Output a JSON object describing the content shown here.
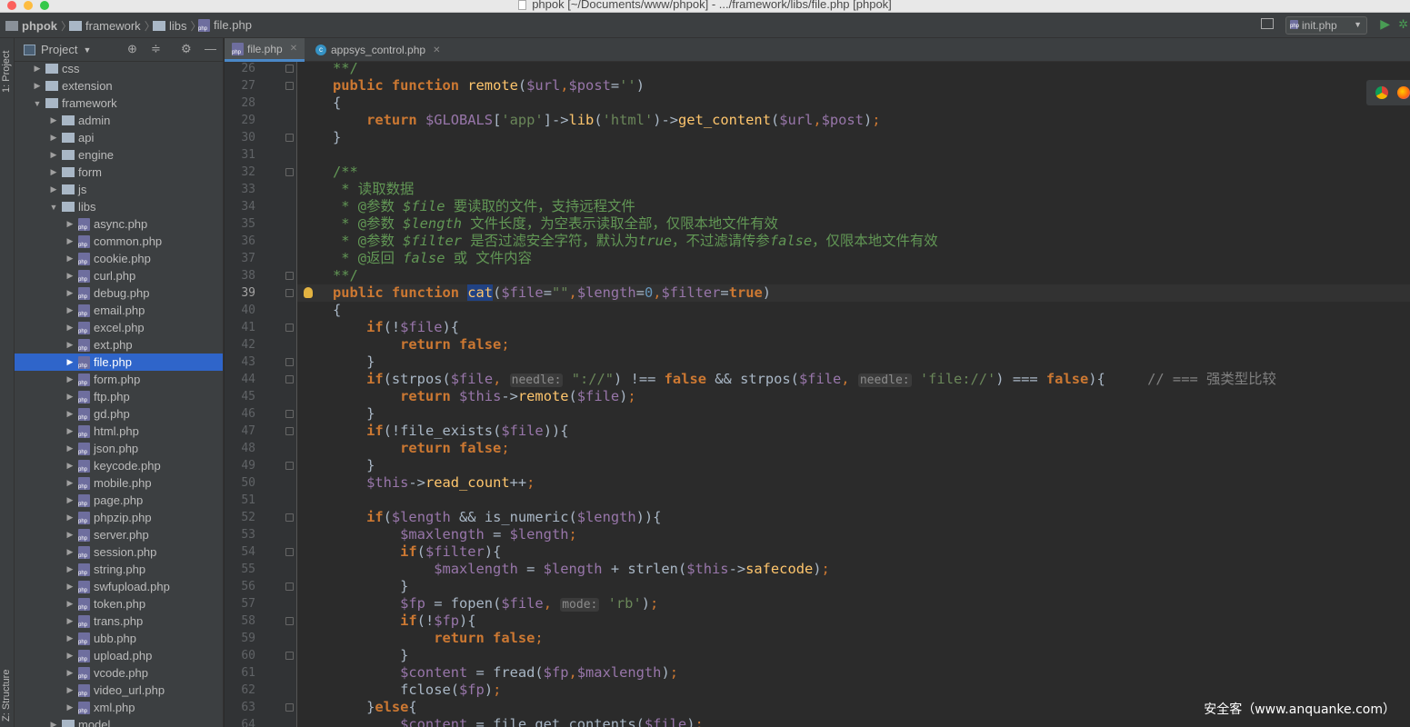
{
  "window": {
    "title": "phpok [~/Documents/www/phpok] - .../framework/libs/file.php [phpok]"
  },
  "breadcrumb": [
    "phpok",
    "framework",
    "libs",
    "file.php"
  ],
  "run_config": {
    "label": "init.php"
  },
  "tool_stripe": {
    "project_label": "1: Project",
    "structure_label": "Z: Structure"
  },
  "project_panel": {
    "title": "Project",
    "items": [
      {
        "label": "css",
        "depth": 1,
        "type": "folder",
        "expanded": false
      },
      {
        "label": "extension",
        "depth": 1,
        "type": "folder",
        "expanded": false
      },
      {
        "label": "framework",
        "depth": 1,
        "type": "folder",
        "expanded": true
      },
      {
        "label": "admin",
        "depth": 2,
        "type": "folder",
        "expanded": false
      },
      {
        "label": "api",
        "depth": 2,
        "type": "folder",
        "expanded": false
      },
      {
        "label": "engine",
        "depth": 2,
        "type": "folder",
        "expanded": false
      },
      {
        "label": "form",
        "depth": 2,
        "type": "folder",
        "expanded": false
      },
      {
        "label": "js",
        "depth": 2,
        "type": "folder",
        "expanded": false
      },
      {
        "label": "libs",
        "depth": 2,
        "type": "folder",
        "expanded": true
      },
      {
        "label": "async.php",
        "depth": 3,
        "type": "php"
      },
      {
        "label": "common.php",
        "depth": 3,
        "type": "php"
      },
      {
        "label": "cookie.php",
        "depth": 3,
        "type": "php"
      },
      {
        "label": "curl.php",
        "depth": 3,
        "type": "php"
      },
      {
        "label": "debug.php",
        "depth": 3,
        "type": "php"
      },
      {
        "label": "email.php",
        "depth": 3,
        "type": "php"
      },
      {
        "label": "excel.php",
        "depth": 3,
        "type": "php"
      },
      {
        "label": "ext.php",
        "depth": 3,
        "type": "php"
      },
      {
        "label": "file.php",
        "depth": 3,
        "type": "php",
        "selected": true
      },
      {
        "label": "form.php",
        "depth": 3,
        "type": "php"
      },
      {
        "label": "ftp.php",
        "depth": 3,
        "type": "php"
      },
      {
        "label": "gd.php",
        "depth": 3,
        "type": "php"
      },
      {
        "label": "html.php",
        "depth": 3,
        "type": "php"
      },
      {
        "label": "json.php",
        "depth": 3,
        "type": "php"
      },
      {
        "label": "keycode.php",
        "depth": 3,
        "type": "php"
      },
      {
        "label": "mobile.php",
        "depth": 3,
        "type": "php"
      },
      {
        "label": "page.php",
        "depth": 3,
        "type": "php"
      },
      {
        "label": "phpzip.php",
        "depth": 3,
        "type": "php"
      },
      {
        "label": "server.php",
        "depth": 3,
        "type": "php"
      },
      {
        "label": "session.php",
        "depth": 3,
        "type": "php"
      },
      {
        "label": "string.php",
        "depth": 3,
        "type": "php"
      },
      {
        "label": "swfupload.php",
        "depth": 3,
        "type": "php"
      },
      {
        "label": "token.php",
        "depth": 3,
        "type": "php"
      },
      {
        "label": "trans.php",
        "depth": 3,
        "type": "php"
      },
      {
        "label": "ubb.php",
        "depth": 3,
        "type": "php"
      },
      {
        "label": "upload.php",
        "depth": 3,
        "type": "php"
      },
      {
        "label": "vcode.php",
        "depth": 3,
        "type": "php"
      },
      {
        "label": "video_url.php",
        "depth": 3,
        "type": "php"
      },
      {
        "label": "xml.php",
        "depth": 3,
        "type": "php"
      },
      {
        "label": "model",
        "depth": 2,
        "type": "folder",
        "expanded": false
      }
    ]
  },
  "tabs": [
    {
      "label": "file.php",
      "active": true,
      "icon": "php-file-icon"
    },
    {
      "label": "appsys_control.php",
      "active": false,
      "icon": "class-icon"
    }
  ],
  "editor": {
    "current_line": 39,
    "lines": [
      {
        "n": 26,
        "tokens": [
          [
            "cmt",
            "**/"
          ]
        ]
      },
      {
        "n": 27,
        "tokens": [
          [
            "kw",
            "public function "
          ],
          [
            "fn",
            "remote"
          ],
          [
            "plain",
            "("
          ],
          [
            "var",
            "$url"
          ],
          [
            "kwn",
            ","
          ],
          [
            "var",
            "$post"
          ],
          [
            "plain",
            "="
          ],
          [
            "str",
            "''"
          ],
          [
            "plain",
            ")"
          ]
        ]
      },
      {
        "n": 28,
        "tokens": [
          [
            "plain",
            "{"
          ]
        ]
      },
      {
        "n": 29,
        "tokens": [
          [
            "kw",
            "    return "
          ],
          [
            "var",
            "$GLOBALS"
          ],
          [
            "plain",
            "["
          ],
          [
            "str",
            "'app'"
          ],
          [
            "plain",
            "]->"
          ],
          [
            "fn",
            "lib"
          ],
          [
            "plain",
            "("
          ],
          [
            "str",
            "'html'"
          ],
          [
            "plain",
            ")->"
          ],
          [
            "fn",
            "get_content"
          ],
          [
            "plain",
            "("
          ],
          [
            "var",
            "$url"
          ],
          [
            "kwn",
            ","
          ],
          [
            "var",
            "$post"
          ],
          [
            "plain",
            ")"
          ],
          [
            "kwn",
            ";"
          ]
        ]
      },
      {
        "n": 30,
        "tokens": [
          [
            "plain",
            "}"
          ]
        ]
      },
      {
        "n": 31,
        "tokens": []
      },
      {
        "n": 32,
        "tokens": [
          [
            "cmt",
            "/**"
          ]
        ]
      },
      {
        "n": 33,
        "tokens": [
          [
            "cmt",
            " * 读取数据"
          ]
        ]
      },
      {
        "n": 34,
        "tokens": [
          [
            "cmt",
            " * @参数 "
          ],
          [
            "cmti",
            "$file"
          ],
          [
            "cmt",
            " 要读取的文件，支持远程文件"
          ]
        ]
      },
      {
        "n": 35,
        "tokens": [
          [
            "cmt",
            " * @参数 "
          ],
          [
            "cmti",
            "$length"
          ],
          [
            "cmt",
            " 文件长度，为空表示读取全部，仅限本地文件有效"
          ]
        ]
      },
      {
        "n": 36,
        "tokens": [
          [
            "cmt",
            " * @参数 "
          ],
          [
            "cmti",
            "$filter"
          ],
          [
            "cmt",
            " 是否过滤安全字符，默认为"
          ],
          [
            "cmti",
            "true"
          ],
          [
            "cmt",
            "，不过滤请传参"
          ],
          [
            "cmti",
            "false"
          ],
          [
            "cmt",
            "，仅限本地文件有效"
          ]
        ]
      },
      {
        "n": 37,
        "tokens": [
          [
            "cmt",
            " * @返回 "
          ],
          [
            "cmti",
            "false"
          ],
          [
            "cmt",
            " 或 文件内容"
          ]
        ]
      },
      {
        "n": 38,
        "tokens": [
          [
            "cmt",
            "**/"
          ]
        ]
      },
      {
        "n": 39,
        "tokens": [
          [
            "kw",
            "public function "
          ],
          [
            "fn hlsel",
            "cat"
          ],
          [
            "plain",
            "("
          ],
          [
            "var",
            "$file"
          ],
          [
            "plain",
            "="
          ],
          [
            "str",
            "\"\""
          ],
          [
            "kwn",
            ","
          ],
          [
            "var",
            "$length"
          ],
          [
            "plain",
            "="
          ],
          [
            "num",
            "0"
          ],
          [
            "kwn",
            ","
          ],
          [
            "var",
            "$filter"
          ],
          [
            "plain",
            "="
          ],
          [
            "kw",
            "true"
          ],
          [
            "plain",
            ")"
          ]
        ]
      },
      {
        "n": 40,
        "tokens": [
          [
            "plain",
            "{"
          ]
        ]
      },
      {
        "n": 41,
        "tokens": [
          [
            "kw",
            "    if"
          ],
          [
            "plain",
            "(!"
          ],
          [
            "var",
            "$file"
          ],
          [
            "plain",
            "){"
          ]
        ]
      },
      {
        "n": 42,
        "tokens": [
          [
            "kw",
            "        return false"
          ],
          [
            "kwn",
            ";"
          ]
        ]
      },
      {
        "n": 43,
        "tokens": [
          [
            "plain",
            "    }"
          ]
        ]
      },
      {
        "n": 44,
        "tokens": [
          [
            "kw",
            "    if"
          ],
          [
            "plain",
            "(strpos("
          ],
          [
            "var",
            "$file"
          ],
          [
            "kwn",
            ", "
          ],
          [
            "hint",
            "needle:"
          ],
          [
            "str",
            " \"://\""
          ],
          [
            "plain",
            ") !== "
          ],
          [
            "kw",
            "false"
          ],
          [
            "plain",
            " && strpos("
          ],
          [
            "var",
            "$file"
          ],
          [
            "kwn",
            ", "
          ],
          [
            "hint",
            "needle:"
          ],
          [
            "str",
            " 'file://'"
          ],
          [
            "plain",
            ") === "
          ],
          [
            "kw",
            "false"
          ],
          [
            "plain",
            "){     "
          ],
          [
            "cmt2",
            "// === 强类型比较"
          ]
        ]
      },
      {
        "n": 45,
        "tokens": [
          [
            "kw",
            "        return "
          ],
          [
            "var",
            "$this"
          ],
          [
            "plain",
            "->"
          ],
          [
            "fn",
            "remote"
          ],
          [
            "plain",
            "("
          ],
          [
            "var",
            "$file"
          ],
          [
            "plain",
            ")"
          ],
          [
            "kwn",
            ";"
          ]
        ]
      },
      {
        "n": 46,
        "tokens": [
          [
            "plain",
            "    }"
          ]
        ]
      },
      {
        "n": 47,
        "tokens": [
          [
            "kw",
            "    if"
          ],
          [
            "plain",
            "(!file_exists("
          ],
          [
            "var",
            "$file"
          ],
          [
            "plain",
            ")){"
          ]
        ]
      },
      {
        "n": 48,
        "tokens": [
          [
            "kw",
            "        return false"
          ],
          [
            "kwn",
            ";"
          ]
        ]
      },
      {
        "n": 49,
        "tokens": [
          [
            "plain",
            "    }"
          ]
        ]
      },
      {
        "n": 50,
        "tokens": [
          [
            "var",
            "    $this"
          ],
          [
            "plain",
            "->"
          ],
          [
            "fn",
            "read_count"
          ],
          [
            "plain",
            "++"
          ],
          [
            "kwn",
            ";"
          ]
        ]
      },
      {
        "n": 51,
        "tokens": []
      },
      {
        "n": 52,
        "tokens": [
          [
            "kw",
            "    if"
          ],
          [
            "plain",
            "("
          ],
          [
            "var",
            "$length"
          ],
          [
            "plain",
            " && is_numeric("
          ],
          [
            "var",
            "$length"
          ],
          [
            "plain",
            ")){"
          ]
        ]
      },
      {
        "n": 53,
        "tokens": [
          [
            "var",
            "        $maxlength"
          ],
          [
            "plain",
            " = "
          ],
          [
            "var",
            "$length"
          ],
          [
            "kwn",
            ";"
          ]
        ]
      },
      {
        "n": 54,
        "tokens": [
          [
            "kw",
            "        if"
          ],
          [
            "plain",
            "("
          ],
          [
            "var",
            "$filter"
          ],
          [
            "plain",
            "){"
          ]
        ]
      },
      {
        "n": 55,
        "tokens": [
          [
            "var",
            "            $maxlength"
          ],
          [
            "plain",
            " = "
          ],
          [
            "var",
            "$length"
          ],
          [
            "plain",
            " + strlen("
          ],
          [
            "var",
            "$this"
          ],
          [
            "plain",
            "->"
          ],
          [
            "fn",
            "safecode"
          ],
          [
            "plain",
            ")"
          ],
          [
            "kwn",
            ";"
          ]
        ]
      },
      {
        "n": 56,
        "tokens": [
          [
            "plain",
            "        }"
          ]
        ]
      },
      {
        "n": 57,
        "tokens": [
          [
            "var",
            "        $fp"
          ],
          [
            "plain",
            " = fopen("
          ],
          [
            "var",
            "$file"
          ],
          [
            "kwn",
            ", "
          ],
          [
            "hint",
            "mode:"
          ],
          [
            "str",
            " 'rb'"
          ],
          [
            "plain",
            ")"
          ],
          [
            "kwn",
            ";"
          ]
        ]
      },
      {
        "n": 58,
        "tokens": [
          [
            "kw",
            "        if"
          ],
          [
            "plain",
            "(!"
          ],
          [
            "var",
            "$fp"
          ],
          [
            "plain",
            "){"
          ]
        ]
      },
      {
        "n": 59,
        "tokens": [
          [
            "kw",
            "            return false"
          ],
          [
            "kwn",
            ";"
          ]
        ]
      },
      {
        "n": 60,
        "tokens": [
          [
            "plain",
            "        }"
          ]
        ]
      },
      {
        "n": 61,
        "tokens": [
          [
            "var",
            "        $content"
          ],
          [
            "plain",
            " = fread("
          ],
          [
            "var",
            "$fp"
          ],
          [
            "kwn",
            ","
          ],
          [
            "var",
            "$maxlength"
          ],
          [
            "plain",
            ")"
          ],
          [
            "kwn",
            ";"
          ]
        ]
      },
      {
        "n": 62,
        "tokens": [
          [
            "plain",
            "        fclose("
          ],
          [
            "var",
            "$fp"
          ],
          [
            "plain",
            ")"
          ],
          [
            "kwn",
            ";"
          ]
        ]
      },
      {
        "n": 63,
        "tokens": [
          [
            "plain",
            "    }"
          ],
          [
            "kw",
            "else"
          ],
          [
            "plain",
            "{"
          ]
        ]
      },
      {
        "n": 64,
        "tokens": [
          [
            "var",
            "        $content"
          ],
          [
            "plain",
            " = file_get_contents("
          ],
          [
            "var",
            "$file"
          ],
          [
            "plain",
            ")"
          ],
          [
            "kwn",
            ";"
          ]
        ]
      }
    ]
  },
  "watermark": "安全客（www.anquanke.com）"
}
